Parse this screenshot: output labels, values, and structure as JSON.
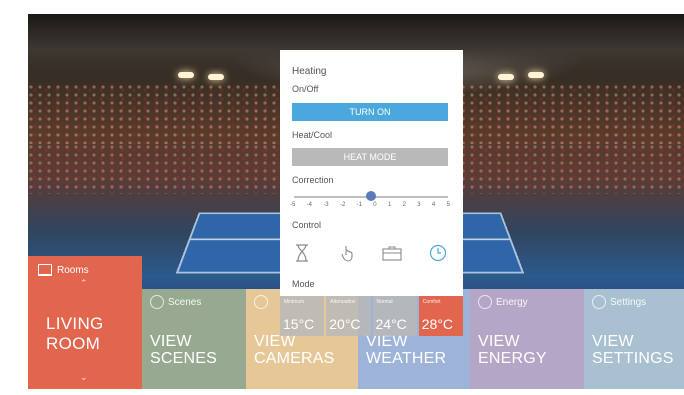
{
  "panel": {
    "title": "Heating",
    "onoff_label": "On/Off",
    "turn_on_button": "TURN ON",
    "heatcool_label": "Heat/Cool",
    "heat_mode_button": "HEAT MODE",
    "correction_label": "Correction",
    "correction_scale": [
      "-5",
      "-4",
      "-3",
      "-2",
      "-1",
      "0",
      "1",
      "2",
      "3",
      "4",
      "5"
    ],
    "correction_value": 0,
    "control_label": "Control",
    "control_icons": [
      "hourglass-icon",
      "hand-touch-icon",
      "suitcase-icon",
      "clock-icon"
    ],
    "mode_label": "Mode",
    "modes": [
      {
        "name": "Minimum",
        "temp": "15°C",
        "active": false
      },
      {
        "name": "Attenuation",
        "temp": "20°C",
        "active": false
      },
      {
        "name": "Normal",
        "temp": "24°C",
        "active": false
      },
      {
        "name": "Comfort",
        "temp": "28°C",
        "active": true
      }
    ],
    "accent_color": "#4aa8dc",
    "mode_active_color": "#e2664e"
  },
  "rooms_tile": {
    "label": "Rooms",
    "name_line1": "LIVING",
    "name_line2": "ROOM",
    "color": "#e2664e"
  },
  "tiles": [
    {
      "key": "scenes",
      "label": "Scenes",
      "big1": "VIEW",
      "big2": "SCENES",
      "color": "#97a990"
    },
    {
      "key": "cameras",
      "label": "",
      "big1": "VIEW",
      "big2": "CAMERAS",
      "color": "#e6c898"
    },
    {
      "key": "weather",
      "label": "",
      "big1": "VIEW",
      "big2": "WEATHER",
      "color": "#9db3d8"
    },
    {
      "key": "energy",
      "label": "Energy",
      "big1": "VIEW",
      "big2": "ENERGY",
      "color": "#b3a6c6"
    },
    {
      "key": "settings",
      "label": "Settings",
      "big1": "VIEW",
      "big2": "SETTINGS",
      "color": "#a8c0d0"
    }
  ]
}
